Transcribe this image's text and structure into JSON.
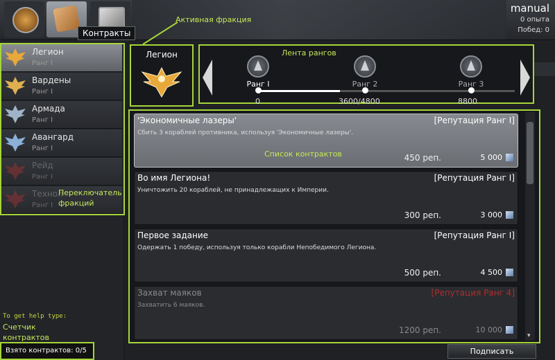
{
  "header": {
    "tooltip": "Контракты",
    "player_name": "manual",
    "experience": "0 опыта",
    "wins": "Побед: 0",
    "tabs": [
      {
        "icon": "brain-icon"
      },
      {
        "icon": "contracts-icon"
      },
      {
        "icon": "cubes-icon"
      }
    ]
  },
  "annotations": {
    "active_faction": "Активная фракция",
    "rank_ribbon": "Лента рангов",
    "contract_list": "Список контрактов",
    "faction_switcher": "Переключатель фракций",
    "contract_counter": "Счетчик контрактов"
  },
  "factions": [
    {
      "name": "Легион",
      "rank": "Ранг I",
      "selected": true
    },
    {
      "name": "Вардены",
      "rank": "Ранг I"
    },
    {
      "name": "Армада",
      "rank": "Ранг I"
    },
    {
      "name": "Авангард",
      "rank": "Ранг I"
    },
    {
      "name": "Рейд",
      "rank": "Ранг I"
    },
    {
      "name": "Технол",
      "rank": "Ранг I"
    }
  ],
  "active_faction": {
    "name": "Легион"
  },
  "ranks": [
    {
      "label": "Ранг I",
      "value": "0"
    },
    {
      "label": "Ранг 2",
      "value": "3600/4800"
    },
    {
      "label": "Ранг 3",
      "value": "8800"
    }
  ],
  "contracts": [
    {
      "title": "'Экономичные лазеры'",
      "req": "[Репутация Ранг I]",
      "desc": "Сбить 3 кораблей противника, используя 'Экономичные лазеры'.",
      "rep": "450 реп.",
      "credits": "5 000"
    },
    {
      "title": "Во имя Легиона!",
      "req": "[Репутация Ранг I]",
      "desc": "Уничтожить 20 кораблей, не принадлежащих к Империи.",
      "rep": "300 реп.",
      "credits": "3 000"
    },
    {
      "title": "Первое задание",
      "req": "[Репутация Ранг I]",
      "desc": "Одержать 1 победу, используя только корабли Непобедимого Легиона.",
      "rep": "500 реп.",
      "credits": "4 500"
    },
    {
      "title": "Захват маяков",
      "req": "[Репутация Ранг 4]",
      "desc": "Захватить 6 маяков.",
      "rep": "1200 реп.",
      "credits": "10 000"
    }
  ],
  "footer": {
    "help_text": "To get help type:",
    "taken_contracts": "Взято контрактов: 0/5",
    "sign_button": "Подписать"
  },
  "colors": {
    "highlight": "#a6d63a",
    "locked_requirement": "#b32c2c"
  }
}
